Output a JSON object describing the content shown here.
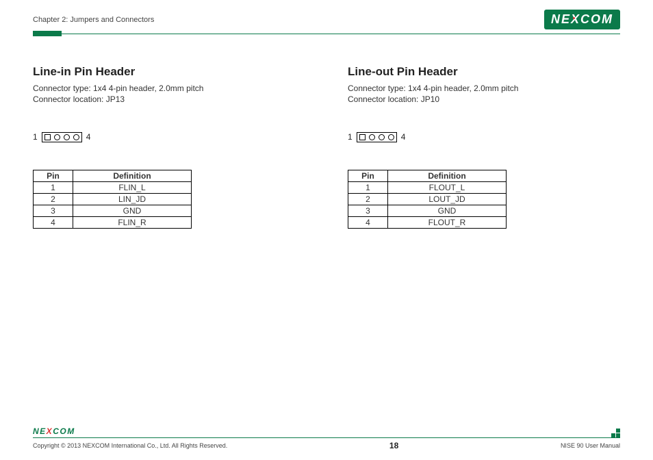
{
  "header": {
    "chapter": "Chapter 2: Jumpers and Connectors",
    "brand": "NE COM",
    "brand_x": "X"
  },
  "sections": {
    "left": {
      "title": "Line-in Pin Header",
      "conn_type": "Connector type: 1x4 4-pin header, 2.0mm pitch",
      "conn_loc": "Connector location: JP13",
      "pin_start": "1",
      "pin_end": "4",
      "th_pin": "Pin",
      "th_def": "Definition",
      "rows": [
        {
          "pin": "1",
          "def": "FLIN_L"
        },
        {
          "pin": "2",
          "def": "LIN_JD"
        },
        {
          "pin": "3",
          "def": "GND"
        },
        {
          "pin": "4",
          "def": "FLIN_R"
        }
      ]
    },
    "right": {
      "title": "Line-out Pin Header",
      "conn_type": "Connector type: 1x4 4-pin header, 2.0mm pitch",
      "conn_loc": "Connector location: JP10",
      "pin_start": "1",
      "pin_end": "4",
      "th_pin": "Pin",
      "th_def": "Definition",
      "rows": [
        {
          "pin": "1",
          "def": "FLOUT_L"
        },
        {
          "pin": "2",
          "def": "LOUT_JD"
        },
        {
          "pin": "3",
          "def": "GND"
        },
        {
          "pin": "4",
          "def": "FLOUT_R"
        }
      ]
    }
  },
  "footer": {
    "brand_small": "NEXCOM",
    "copyright": "Copyright © 2013 NEXCOM International Co., Ltd. All Rights Reserved.",
    "page": "18",
    "manual": "NISE 90 User Manual"
  }
}
